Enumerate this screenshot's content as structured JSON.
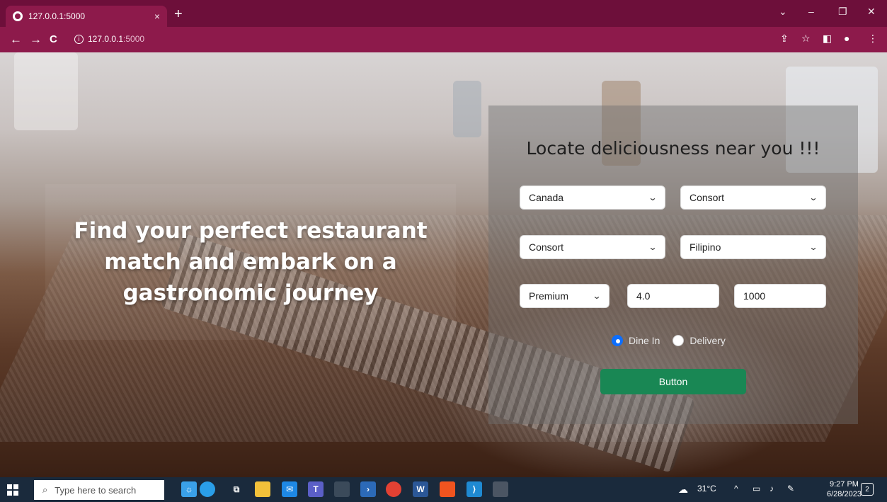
{
  "browser": {
    "tab_title": "127.0.0.1:5000",
    "tab_close": "×",
    "new_tab": "+",
    "url_host": "127.0.0.1",
    "url_path": ":5000",
    "nav": {
      "back": "←",
      "forward": "→",
      "reload": "C"
    }
  },
  "hero": {
    "text": "Find your perfect restaurant match and embark on a gastronomic journey"
  },
  "form": {
    "title": "Locate deliciousness near you !!!",
    "country": "Canada",
    "city": "Consort",
    "locality": "Consort",
    "cuisine": "Filipino",
    "price_range": "Premium",
    "rating": "4.0",
    "votes": "1000",
    "radio": {
      "dine_in": "Dine In",
      "delivery": "Delivery",
      "selected": "Dine In"
    },
    "button_label": "Button"
  },
  "taskbar": {
    "search_placeholder": "Type here to search",
    "weather": "31°C",
    "time": "9:27 PM",
    "date": "6/28/2023",
    "notifications": "2"
  },
  "colors": {
    "chrome": "#6d0f3a",
    "address_bar": "#8d1a4b",
    "button": "#198754",
    "radio_checked": "#0d6efd"
  }
}
